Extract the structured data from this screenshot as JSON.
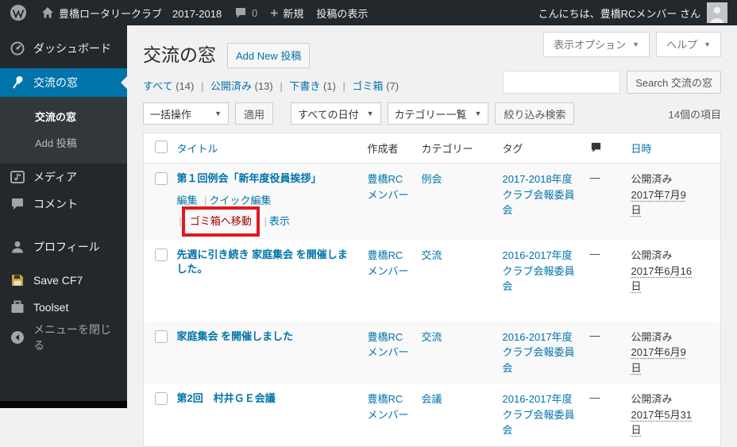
{
  "colors": {
    "accent_blue": "#0073aa",
    "admin_dark": "#23282d",
    "submenu_dark": "#32373c",
    "content_bg": "#f1f1f1",
    "trash_link_red": "#a00000",
    "annotation_red": "#e0191f",
    "icon_gray": "#a0a5aa",
    "floppy_gold": "#cba135"
  },
  "ui": {
    "caret": "▼",
    "separator": "|",
    "plus_glyph": "+"
  },
  "admin_bar": {
    "site_name": "豊橋ロータリークラブ　2017-2018",
    "comment_count": "0",
    "new_label": "新規",
    "view_posts_label": "投稿の表示",
    "greeting": "こんにちは、豊橋RCメンバー さん"
  },
  "sidebar": {
    "items": [
      {
        "label": "ダッシュボード"
      },
      {
        "label": "交流の窓"
      },
      {
        "label": "メディア"
      },
      {
        "label": "コメント"
      },
      {
        "label": "プロフィール"
      },
      {
        "label": "Save CF7"
      },
      {
        "label": "Toolset"
      },
      {
        "label": "メニューを閉じる"
      }
    ],
    "submenu": [
      {
        "label": "交流の窓"
      },
      {
        "label": "Add 投稿"
      }
    ]
  },
  "page": {
    "title": "交流の窓",
    "add_new_label": "Add New 投稿",
    "screen_options_label": "表示オプション",
    "help_label": "ヘルプ",
    "items_count": "14個の項目"
  },
  "filters": [
    {
      "label": "すべて",
      "count": "(14)"
    },
    {
      "label": "公開済み",
      "count": "(13)"
    },
    {
      "label": "下書き",
      "count": "(1)"
    },
    {
      "label": "ゴミ箱",
      "count": "(7)"
    }
  ],
  "search": {
    "value": "",
    "button_label": "Search 交流の窓"
  },
  "toolbar": {
    "bulk_action_label": "一括操作",
    "apply_label": "適用",
    "date_filter_label": "すべての日付",
    "category_filter_label": "カテゴリー一覧",
    "filter_button_label": "絞り込み検索"
  },
  "table": {
    "headers": {
      "title": "タイトル",
      "author": "作成者",
      "category": "カテゴリー",
      "tags": "タグ",
      "date": "日時"
    },
    "rows": [
      {
        "title": "第１回例会「新年度役員挨拶」",
        "actions": {
          "edit": "編集",
          "quick_edit": "クイック編集",
          "trash": "ゴミ箱へ移動",
          "view": "表示"
        },
        "author": "豊橋RCメンバー",
        "category": "例会",
        "tags": "2017-2018年度 クラブ会報委員会",
        "comments": "—",
        "status": "公開済み",
        "date": "2017年7月9日"
      },
      {
        "title": "先週に引き続き 家庭集会 を開催しました。",
        "author": "豊橋RCメンバー",
        "category": "交流",
        "tags": "2016-2017年度 クラブ会報委員会",
        "comments": "—",
        "status": "公開済み",
        "date": "2017年6月16日"
      },
      {
        "title": "家庭集会 を開催しました",
        "author": "豊橋RCメンバー",
        "category": "交流",
        "tags": "2016-2017年度 クラブ会報委員会",
        "comments": "—",
        "status": "公開済み",
        "date": "2017年6月9日"
      },
      {
        "title": "第2回　村井ＧＥ会議",
        "author": "豊橋RCメンバー",
        "category": "会議",
        "tags": "2016-2017年度 クラブ会報委員会",
        "comments": "—",
        "status": "公開済み",
        "date": "2017年5月31日"
      }
    ]
  }
}
